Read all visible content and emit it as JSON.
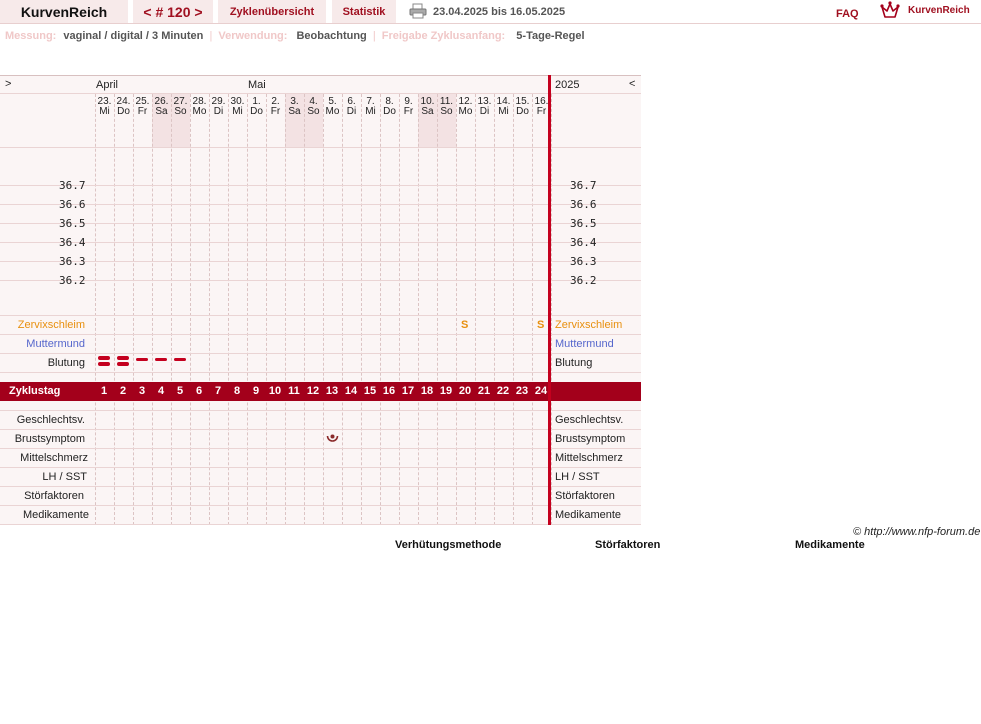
{
  "app": {
    "title": "KurvenReich",
    "cycle_nav": "< # 120 >",
    "tab_overview": "Zyklenübersicht",
    "tab_stats": "Statistik",
    "date_range": "23.04.2025 bis 16.05.2025",
    "faq": "FAQ",
    "logo_text": "KurvenReich"
  },
  "meta": {
    "measurement_label": "Messung:",
    "measurement_value": "vaginal / digital / 3 Minuten",
    "usage_label": "Verwendung:",
    "usage_value": "Beobachtung",
    "release_label": "Freigabe Zyklusanfang:",
    "release_value": "5-Tage-Regel",
    "sep": "|"
  },
  "chart": {
    "scroll_left": ">",
    "scroll_right": "<",
    "month_april": "April",
    "month_may": "Mai",
    "year": "2025",
    "days": [
      {
        "num": "23.",
        "name": "Mi",
        "weekend": false
      },
      {
        "num": "24.",
        "name": "Do",
        "weekend": false
      },
      {
        "num": "25.",
        "name": "Fr",
        "weekend": false
      },
      {
        "num": "26.",
        "name": "Sa",
        "weekend": true
      },
      {
        "num": "27.",
        "name": "So",
        "weekend": true
      },
      {
        "num": "28.",
        "name": "Mo",
        "weekend": false
      },
      {
        "num": "29.",
        "name": "Di",
        "weekend": false
      },
      {
        "num": "30.",
        "name": "Mi",
        "weekend": false
      },
      {
        "num": "1.",
        "name": "Do",
        "weekend": false
      },
      {
        "num": "2.",
        "name": "Fr",
        "weekend": false
      },
      {
        "num": "3.",
        "name": "Sa",
        "weekend": true
      },
      {
        "num": "4.",
        "name": "So",
        "weekend": true
      },
      {
        "num": "5.",
        "name": "Mo",
        "weekend": false
      },
      {
        "num": "6.",
        "name": "Di",
        "weekend": false
      },
      {
        "num": "7.",
        "name": "Mi",
        "weekend": false
      },
      {
        "num": "8.",
        "name": "Do",
        "weekend": false
      },
      {
        "num": "9.",
        "name": "Fr",
        "weekend": false
      },
      {
        "num": "10.",
        "name": "Sa",
        "weekend": true
      },
      {
        "num": "11.",
        "name": "So",
        "weekend": true
      },
      {
        "num": "12.",
        "name": "Mo",
        "weekend": false
      },
      {
        "num": "13.",
        "name": "Di",
        "weekend": false
      },
      {
        "num": "14.",
        "name": "Mi",
        "weekend": false
      },
      {
        "num": "15.",
        "name": "Do",
        "weekend": false
      },
      {
        "num": "16.",
        "name": "Fr",
        "weekend": false
      }
    ],
    "temperatures": [
      "36.7",
      "36.6",
      "36.5",
      "36.4",
      "36.3",
      "36.2"
    ],
    "rows": {
      "zervix": "Zervixschleim",
      "muttermund": "Muttermund",
      "blutung": "Blutung",
      "zyklustag": "Zyklustag",
      "geschlechtsv": "Geschlechtsv.",
      "brust": "Brustsymptom",
      "mittel": "Mittelschmerz",
      "lh": "LH / SST",
      "stoer": "Störfaktoren",
      "medi": "Medikamente"
    },
    "cycle_days": [
      "1",
      "2",
      "3",
      "4",
      "5",
      "6",
      "7",
      "8",
      "9",
      "10",
      "11",
      "12",
      "13",
      "14",
      "15",
      "16",
      "17",
      "18",
      "19",
      "20",
      "21",
      "22",
      "23",
      "24"
    ],
    "zervix_marks": [
      {
        "day": 20,
        "symbol": "S"
      },
      {
        "day": 24,
        "symbol": "S"
      }
    ],
    "bleeding": [
      {
        "day": 1,
        "level": "heavy"
      },
      {
        "day": 2,
        "level": "heavy"
      },
      {
        "day": 3,
        "level": "light"
      },
      {
        "day": 4,
        "level": "light"
      },
      {
        "day": 5,
        "level": "light"
      }
    ],
    "breast_symptom": [
      {
        "day": 13
      }
    ]
  },
  "footer": {
    "copyright": "© http://www.nfp-forum.de",
    "methode": "Verhütungsmethode",
    "stoer": "Störfaktoren",
    "medi": "Medikamente"
  },
  "colors": {
    "accent": "#a3001b",
    "cervix": "#e8900f",
    "cervix_label": "#e8900f",
    "muttermund_label": "#5566cc"
  },
  "icons": [
    "printer-icon",
    "logo-icon",
    "bleeding-icon",
    "breast-symptom-icon"
  ]
}
